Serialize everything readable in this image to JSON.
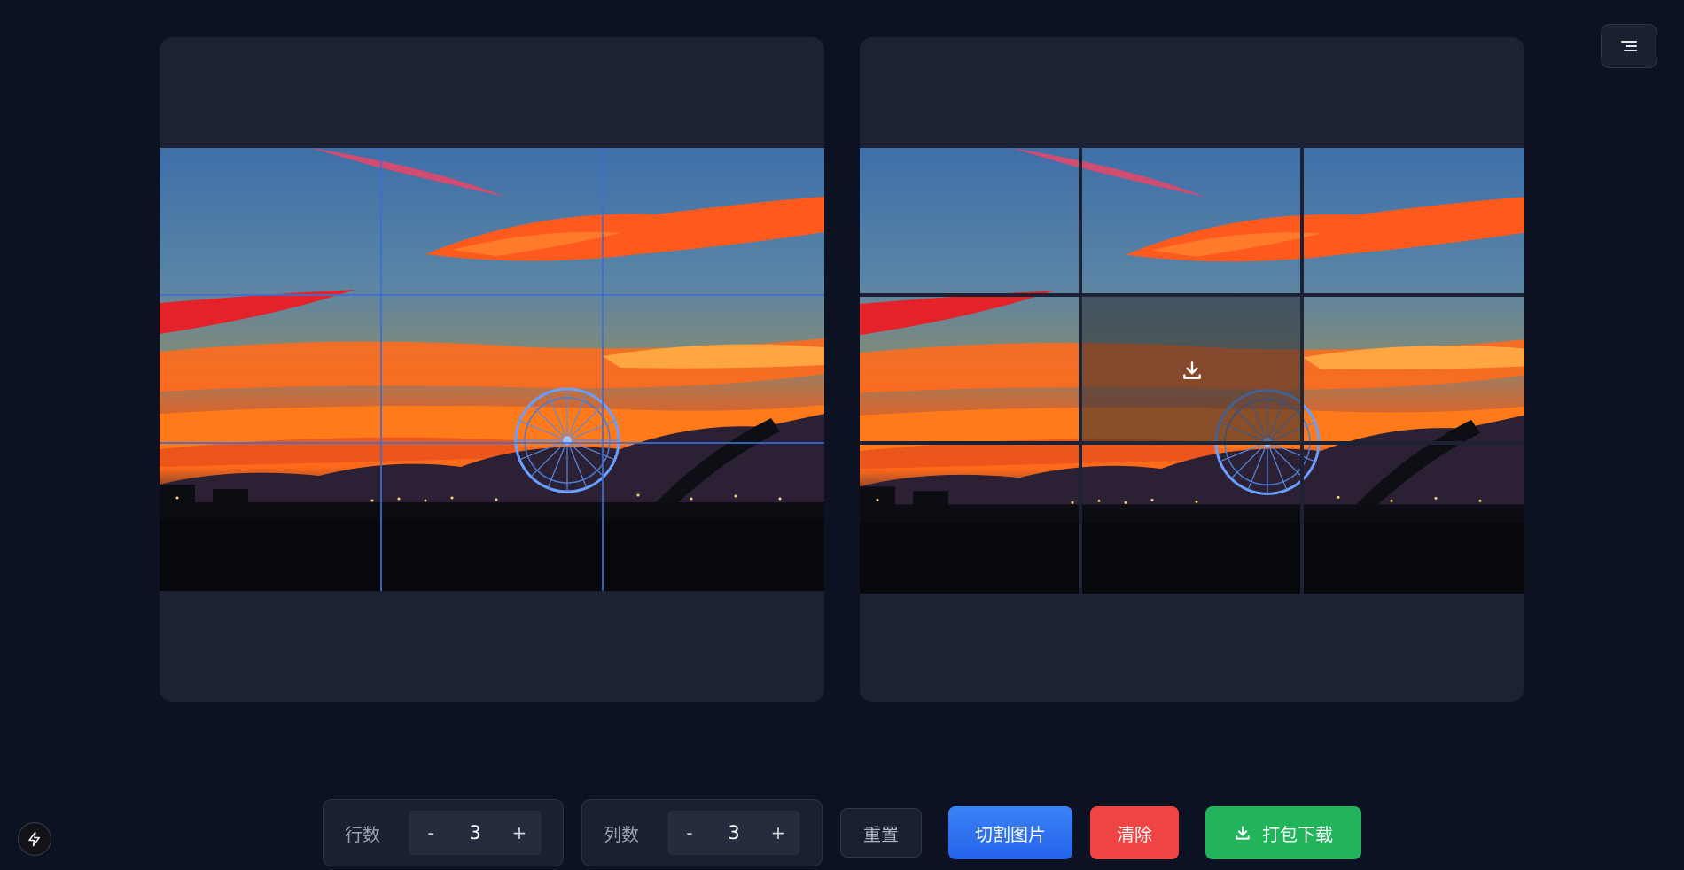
{
  "controls": {
    "rows_label": "行数",
    "rows_value": "3",
    "cols_label": "列数",
    "cols_value": "3",
    "decrement_label": "-",
    "increment_label": "+"
  },
  "actions": {
    "reset_label": "重置",
    "cut_label": "切割图片",
    "clear_label": "清除",
    "download_label": "打包下载"
  },
  "icons": {
    "menu": "menu-icon",
    "tile_download": "download-icon",
    "bolt": "lightning-bolt-icon"
  },
  "colors": {
    "background": "#0c1222",
    "panel": "#1c2233",
    "guide_line": "#3b6fd6",
    "cut_button": "#3b82f6",
    "clear_button": "#ef4444",
    "download_button": "#22b45a"
  }
}
